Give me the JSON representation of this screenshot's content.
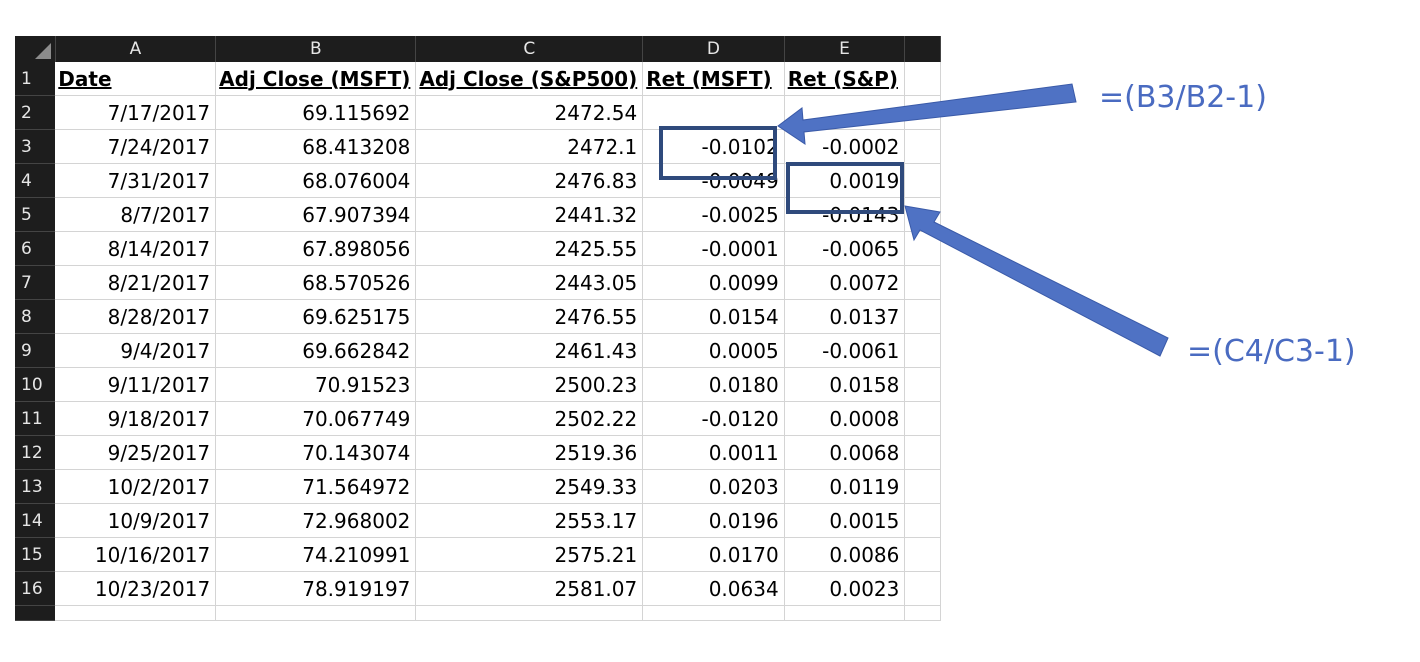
{
  "spreadsheet": {
    "column_headers": [
      "A",
      "B",
      "C",
      "D",
      "E"
    ],
    "header_row": {
      "row_number": "1",
      "cells": [
        "Date",
        "Adj Close (MSFT)",
        "Adj Close (S&P500)",
        "Ret (MSFT)",
        "Ret (S&P)"
      ]
    },
    "rows": [
      {
        "row_number": "2",
        "date": "7/17/2017",
        "msft": "69.115692",
        "sp500": "2472.54",
        "ret_msft": "",
        "ret_sp": ""
      },
      {
        "row_number": "3",
        "date": "7/24/2017",
        "msft": "68.413208",
        "sp500": "2472.1",
        "ret_msft": "-0.0102",
        "ret_sp": "-0.0002"
      },
      {
        "row_number": "4",
        "date": "7/31/2017",
        "msft": "68.076004",
        "sp500": "2476.83",
        "ret_msft": "-0.0049",
        "ret_sp": "0.0019"
      },
      {
        "row_number": "5",
        "date": "8/7/2017",
        "msft": "67.907394",
        "sp500": "2441.32",
        "ret_msft": "-0.0025",
        "ret_sp": "-0.0143"
      },
      {
        "row_number": "6",
        "date": "8/14/2017",
        "msft": "67.898056",
        "sp500": "2425.55",
        "ret_msft": "-0.0001",
        "ret_sp": "-0.0065"
      },
      {
        "row_number": "7",
        "date": "8/21/2017",
        "msft": "68.570526",
        "sp500": "2443.05",
        "ret_msft": "0.0099",
        "ret_sp": "0.0072"
      },
      {
        "row_number": "8",
        "date": "8/28/2017",
        "msft": "69.625175",
        "sp500": "2476.55",
        "ret_msft": "0.0154",
        "ret_sp": "0.0137"
      },
      {
        "row_number": "9",
        "date": "9/4/2017",
        "msft": "69.662842",
        "sp500": "2461.43",
        "ret_msft": "0.0005",
        "ret_sp": "-0.0061"
      },
      {
        "row_number": "10",
        "date": "9/11/2017",
        "msft": "70.91523",
        "sp500": "2500.23",
        "ret_msft": "0.0180",
        "ret_sp": "0.0158"
      },
      {
        "row_number": "11",
        "date": "9/18/2017",
        "msft": "70.067749",
        "sp500": "2502.22",
        "ret_msft": "-0.0120",
        "ret_sp": "0.0008"
      },
      {
        "row_number": "12",
        "date": "9/25/2017",
        "msft": "70.143074",
        "sp500": "2519.36",
        "ret_msft": "0.0011",
        "ret_sp": "0.0068"
      },
      {
        "row_number": "13",
        "date": "10/2/2017",
        "msft": "71.564972",
        "sp500": "2549.33",
        "ret_msft": "0.0203",
        "ret_sp": "0.0119"
      },
      {
        "row_number": "14",
        "date": "10/9/2017",
        "msft": "72.968002",
        "sp500": "2553.17",
        "ret_msft": "0.0196",
        "ret_sp": "0.0015"
      },
      {
        "row_number": "15",
        "date": "10/16/2017",
        "msft": "74.210991",
        "sp500": "2575.21",
        "ret_msft": "0.0170",
        "ret_sp": "0.0086"
      },
      {
        "row_number": "16",
        "date": "10/23/2017",
        "msft": "78.919197",
        "sp500": "2581.07",
        "ret_msft": "0.0634",
        "ret_sp": "0.0023"
      }
    ]
  },
  "annotations": {
    "formula_msft": "=(B3/B2-1)",
    "formula_sp": "=(C4/C3-1)",
    "box_color": "#2f4a7c",
    "arrow_color": "#4f72c4",
    "text_color": "#4a6bc1"
  }
}
